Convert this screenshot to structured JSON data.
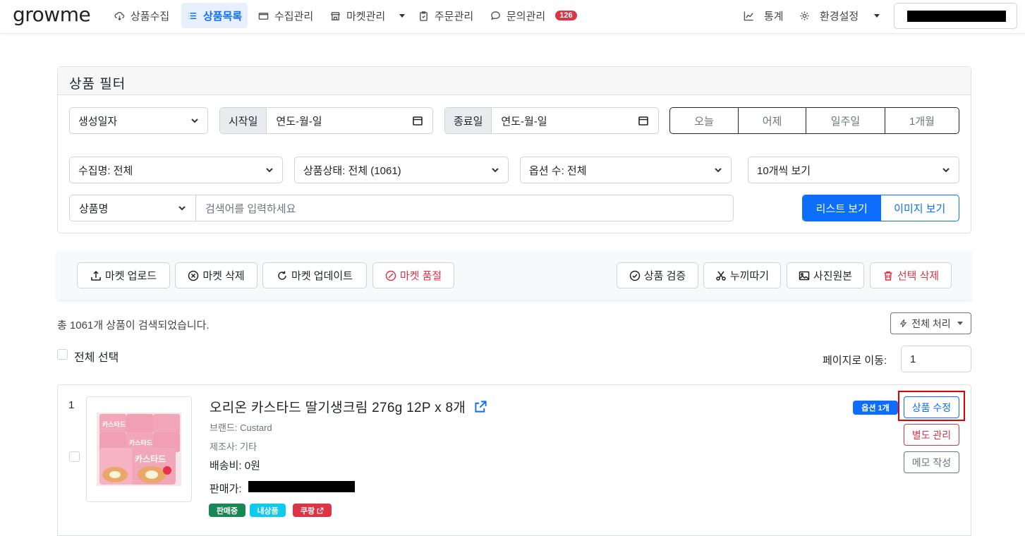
{
  "nav": {
    "logo": "growme",
    "items": [
      {
        "label": "상품수집"
      },
      {
        "label": "상품목록"
      },
      {
        "label": "수집관리"
      },
      {
        "label": "마켓관리"
      },
      {
        "label": "주문관리"
      },
      {
        "label": "문의관리"
      }
    ],
    "inquiry_badge": "126",
    "stats_label": "통계",
    "settings_label": "환경설정"
  },
  "filter": {
    "title": "상품 필터",
    "date_type": "생성일자",
    "start_label": "시작일",
    "start_placeholder": "연도-월-일",
    "end_label": "종료일",
    "end_placeholder": "연도-월-일",
    "quick_ranges": [
      "오늘",
      "어제",
      "일주일",
      "1개월"
    ],
    "collection": "수집명: 전체",
    "status": "상품상태: 전체 (1061)",
    "options": "옵션 수: 전체",
    "per_page": "10개씩 보기",
    "search_field": "상품명",
    "search_placeholder": "검색어를 입력하세요",
    "view_list": "리스트 보기",
    "view_image": "이미지 보기"
  },
  "toolbar": {
    "market_upload": "마켓 업로드",
    "market_delete": "마켓 삭제",
    "market_update": "마켓 업데이트",
    "market_soldout": "마켓 품절",
    "verify": "상품 검증",
    "cutout": "누끼따기",
    "original_photo": "사진원본",
    "delete_selected": "선택 삭제"
  },
  "results": {
    "summary": "총 1061개 상품이 검색되었습니다.",
    "bulk_action": "전체 처리",
    "select_all": "전체 선택",
    "goto_label": "페이지로 이동:",
    "goto_value": "1"
  },
  "product": {
    "index": "1",
    "name": "오리온 카스타드 딸기생크림 276g 12P x 8개",
    "brand": "브랜드: Custard",
    "maker": "제조사: 기타",
    "shipping": "배송비: 0원",
    "price_label": "판매가:",
    "tags": [
      "판매중",
      "내상품",
      "쿠팡"
    ],
    "option_badge": "옵션 1개",
    "edit": "상품 수정",
    "separate": "별도 관리",
    "memo": "메모 작성",
    "thumb_text": "카스타드"
  },
  "colors": {
    "primary": "#0d6efd",
    "danger": "#dc3545",
    "success": "#198754",
    "info": "#0dcaf0"
  }
}
